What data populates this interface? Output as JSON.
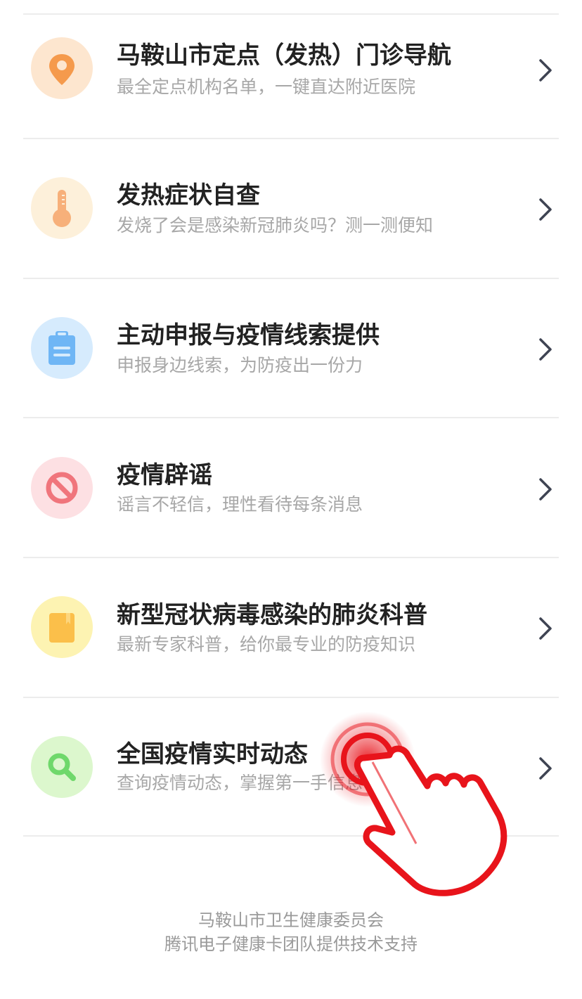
{
  "menu": {
    "items": [
      {
        "title": "马鞍山市定点（发热）门诊导航",
        "subtitle": "最全定点机构名单，一键直达附近医院",
        "icon": "location-pin-icon",
        "icon_bg": "#fde6cf",
        "icon_color": "#f59a4c"
      },
      {
        "title": "发热症状自查",
        "subtitle": "发烧了会是感染新冠肺炎吗？测一测便知",
        "icon": "thermometer-icon",
        "icon_bg": "#fdf0da",
        "icon_color": "#f7b07a"
      },
      {
        "title": "主动申报与疫情线索提供",
        "subtitle": "申报身边线索，为防疫出一份力",
        "icon": "clipboard-icon",
        "icon_bg": "#d6ebfd",
        "icon_color": "#6fb6f5"
      },
      {
        "title": "疫情辟谣",
        "subtitle": "谣言不轻信，理性看待每条消息",
        "icon": "prohibited-icon",
        "icon_bg": "#fde0e3",
        "icon_color": "#f0757c"
      },
      {
        "title": "新型冠状病毒感染的肺炎科普",
        "subtitle": "最新专家科普，给你最专业的防疫知识",
        "icon": "book-icon",
        "icon_bg": "#fdf3b2",
        "icon_color": "#fbbf4a"
      },
      {
        "title": "全国疫情实时动态",
        "subtitle": "查询疫情动态，掌握第一手信息",
        "icon": "magnifier-icon",
        "icon_bg": "#dcf7cd",
        "icon_color": "#6fd86b"
      }
    ]
  },
  "footer": {
    "line1": "马鞍山市卫生健康委员会",
    "line2": "腾讯电子健康卡团队提供技术支持"
  },
  "overlay": {
    "icon": "tap-hand-icon",
    "color": "#e8141b"
  }
}
